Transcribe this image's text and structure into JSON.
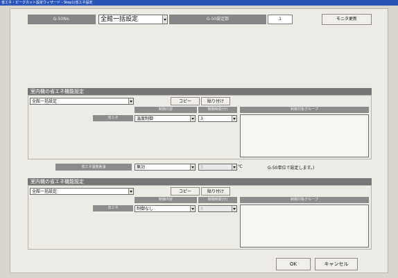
{
  "window": {
    "title": "省エネ・ピークカット設定ウィザード - Step1(省エネ設定"
  },
  "top": {
    "group_no_label": "G-50No.",
    "group_select_value": "全館一括設定",
    "g50_count_label": "G-50設定数",
    "g50_count_value": "1",
    "monitor_button": "モニタ更新"
  },
  "indoor_section": {
    "title": "室内機の省エネ機能設定",
    "select_value": "全館一括設定",
    "copy_button": "コピー",
    "paste_button": "貼り付け",
    "col_control_content": "制御内容",
    "col_control_time": "制御時間(分)",
    "col_target_group": "制御対象グループ",
    "row_label": "省エネ",
    "control_value": "温度制御",
    "time_value": "3"
  },
  "temp_row": {
    "label": "省エネ温度差温",
    "mode_value": "無効",
    "temp_value": "3",
    "unit": "℃",
    "note": "G-50単位で設定します。)"
  },
  "indoor_section2": {
    "title": "室内機の省エネ機能設定",
    "select_value": "全館一括設定",
    "copy_button": "コピー",
    "paste_button": "貼り付け",
    "col_control_content": "制御内容",
    "col_control_time": "制御時間(分)",
    "col_target_group": "制御対象グループ",
    "row_label": "省エネ",
    "control_value": "制御なし",
    "time_value": "3"
  },
  "footer": {
    "ok_button": "OK",
    "cancel_button": "キャンセル"
  }
}
